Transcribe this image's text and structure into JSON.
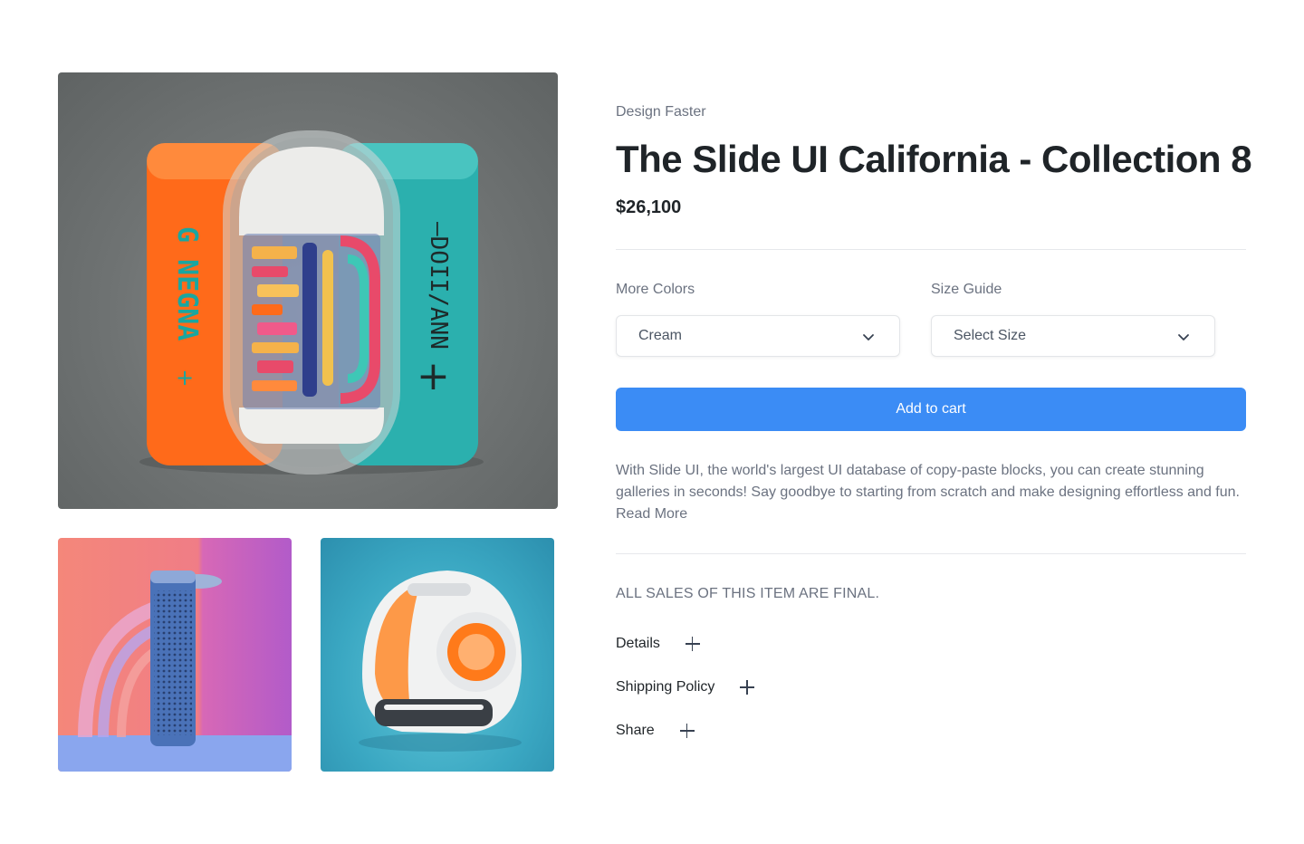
{
  "gallery": {
    "main_image": "capsule-product-render",
    "thumbnails": [
      "cylinder-speaker-render",
      "robot-helmet-render"
    ]
  },
  "product": {
    "eyebrow": "Design Faster",
    "title": "The Slide UI California - Collection 8",
    "price": "$26,100"
  },
  "options": {
    "colors_label": "More Colors",
    "colors_value": "Cream",
    "size_label": "Size Guide",
    "size_value": "Select Size"
  },
  "cart": {
    "button_label": "Add to cart"
  },
  "description": {
    "text": "With Slide UI, the world's largest UI database of copy-paste blocks, you can create stunning galleries in seconds! Say goodbye to starting from scratch and make designing effortless and fun. ",
    "read_more": "Read More"
  },
  "policy": {
    "final_sale": "ALL SALES OF THIS ITEM ARE FINAL.",
    "accordion": [
      "Details",
      "Shipping Policy",
      "Share"
    ]
  },
  "colors": {
    "accent": "#3b8cf5",
    "text_dark": "#1f2428",
    "text_muted": "#6b7280",
    "divider": "#e6e8eb"
  }
}
